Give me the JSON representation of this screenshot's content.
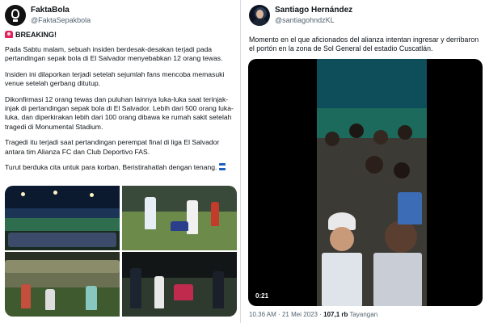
{
  "left_tweet": {
    "name": "FaktaBola",
    "handle": "@FaktaSepakbola",
    "breaking": "BREAKING!",
    "paragraphs": [
      "Pada Sabtu malam, sebuah insiden berdesak-desakan terjadi pada pertandingan sepak bola di El Salvador menyebabkan 12 orang tewas.",
      "Insiden ini dilaporkan terjadi setelah sejumlah fans mencoba memasuki venue setelah gerbang ditutup.",
      "Dikonfirmasi 12 orang tewas dan puluhan lainnya luka-luka saat terinjak-injak di pertandingan sepak bola di El Salvador. Lebih dari 500 orang luka-luka, dan diperkirakan lebih dari 100 orang dibawa ke rumah sakit setelah tragedi di Monumental Stadium.",
      "Tragedi itu terjadi saat pertandingan perempat final di liga El Salvador antara tim Alianza FC dan Club Deportivo FAS.",
      "Turut berduka cita untuk para korban, Beristirahatlah dengan tenang."
    ],
    "icons": {
      "avatar": "lightbulb-logo-icon",
      "breaking": "siren-icon",
      "flag": "el-salvador-flag-icon"
    }
  },
  "right_tweet": {
    "name": "Santiago Hernández",
    "handle": "@santiagohndzKL",
    "text": "Momento en el que aficionados del alianza intentan ingresar y derribaron el portón en la zona de Sol General del estadio Cuscatlán.",
    "video_duration": "0:21",
    "time": "10.36 AM",
    "date": "21 Mei 2023",
    "separator": "·",
    "views_count": "107,1 rb",
    "views_label": "Tayangan"
  }
}
